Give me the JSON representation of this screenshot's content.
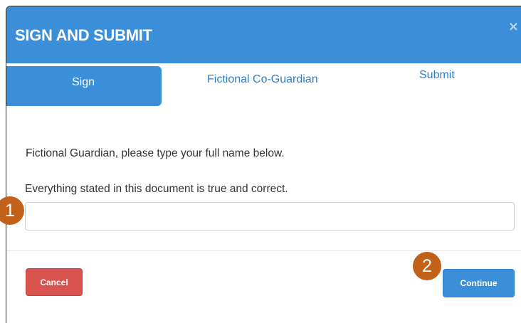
{
  "dialog": {
    "title": "SIGN AND SUBMIT",
    "close_icon": "×"
  },
  "tabs": [
    {
      "label": "Sign",
      "active": true
    },
    {
      "label": "Fictional Co-Guardian",
      "active": false
    },
    {
      "label": "Submit",
      "active": false
    }
  ],
  "form": {
    "instruction": "Fictional Guardian, please type your full name below.",
    "statement": "Everything stated in this document is true and correct.",
    "name_value": "",
    "name_placeholder": ""
  },
  "buttons": {
    "cancel_label": "Cancel",
    "continue_label": "Continue"
  },
  "markers": {
    "first": "1",
    "second": "2"
  },
  "colors": {
    "primary": "#3b8fd9",
    "danger": "#d9534f",
    "marker": "#c1611a"
  },
  "icons": {
    "close": "close-icon"
  }
}
